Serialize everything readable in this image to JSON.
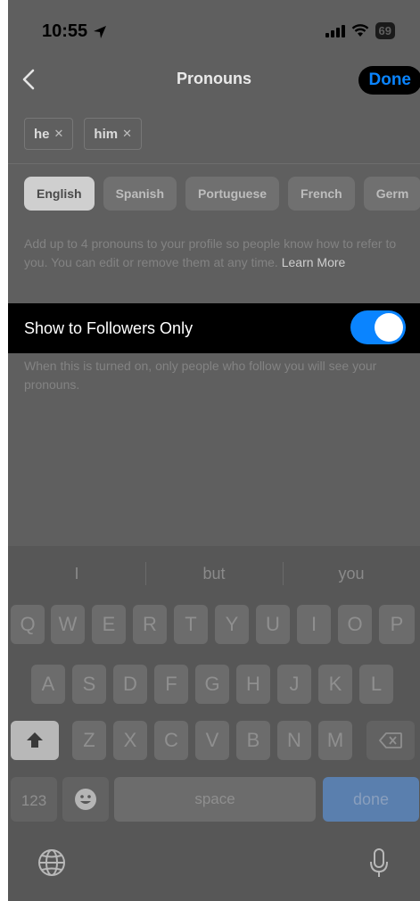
{
  "status": {
    "time": "10:55",
    "battery": "69"
  },
  "nav": {
    "title": "Pronouns",
    "done_label": "Done"
  },
  "chips": [
    {
      "label": "he"
    },
    {
      "label": "him"
    }
  ],
  "languages": [
    "English",
    "Spanish",
    "Portuguese",
    "French",
    "Germ"
  ],
  "info": {
    "text": "Add up to 4 pronouns to your profile so people know how to refer to you. You can edit or remove them at any time.",
    "link": "Learn More"
  },
  "toggle": {
    "label": "Show to Followers Only",
    "on": true
  },
  "toggle_help": "When this is turned on, only people who follow you will see your pronouns.",
  "keyboard": {
    "suggestions": [
      "I",
      "but",
      "you"
    ],
    "row1": [
      "Q",
      "W",
      "E",
      "R",
      "T",
      "Y",
      "U",
      "I",
      "O",
      "P"
    ],
    "row2": [
      "A",
      "S",
      "D",
      "F",
      "G",
      "H",
      "J",
      "K",
      "L"
    ],
    "row3": [
      "Z",
      "X",
      "C",
      "V",
      "B",
      "N",
      "M"
    ],
    "numbers_label": "123",
    "space_label": "space",
    "return_label": "done"
  },
  "colors": {
    "accent": "#0a84ff",
    "highlight_bg": "#000000"
  }
}
